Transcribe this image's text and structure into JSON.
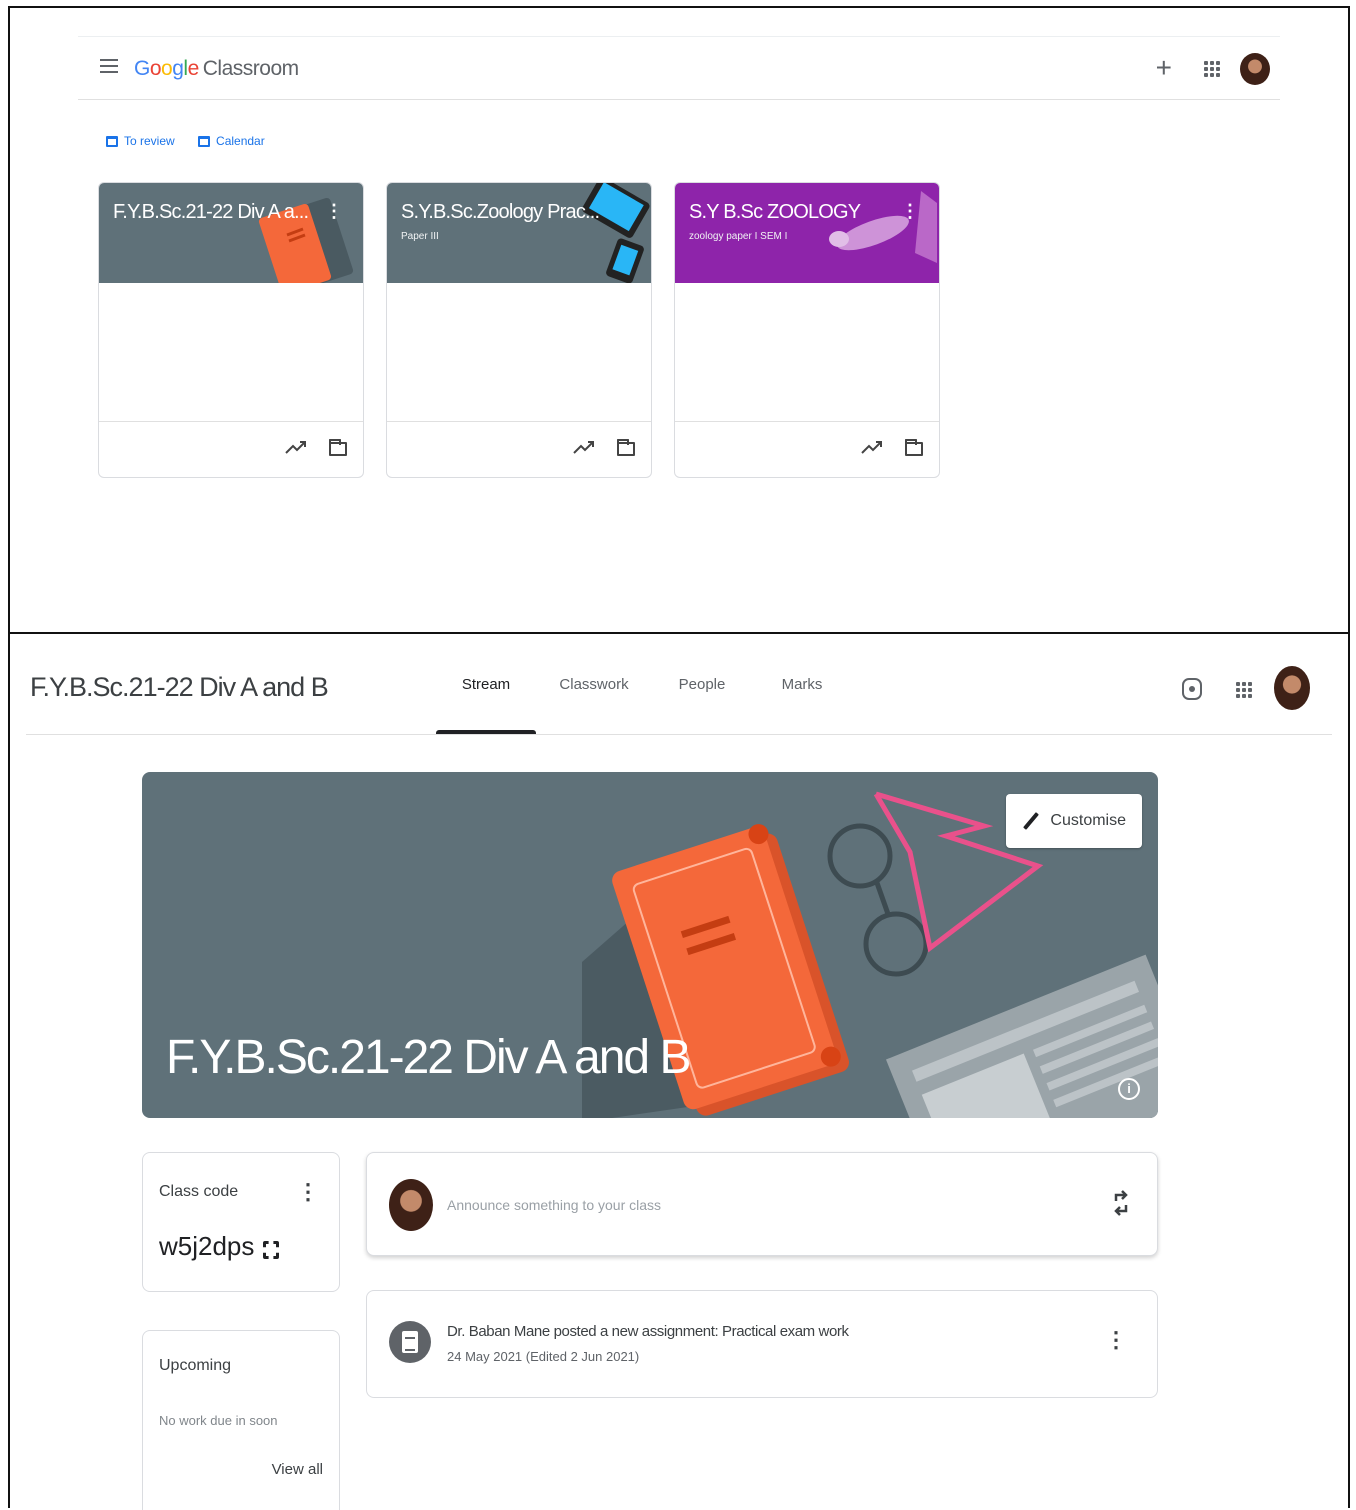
{
  "home": {
    "brand": {
      "google": [
        "G",
        "o",
        "o",
        "g",
        "l",
        "e"
      ],
      "product": "Classroom"
    },
    "quicklinks": {
      "to_review": "To review",
      "calendar": "Calendar"
    },
    "cards": [
      {
        "title": "F.Y.B.Sc.21-22 Div A a...",
        "subtitle": "",
        "color": "#5f7179"
      },
      {
        "title": "S.Y.B.Sc.Zoology Prac...",
        "subtitle": "Paper III",
        "color": "#5f7179"
      },
      {
        "title": "S.Y B.Sc ZOOLOGY",
        "subtitle": "zoology paper I SEM I",
        "color": "#8e24aa"
      }
    ],
    "icons": {
      "menu": "menu-icon",
      "add": "plus-icon",
      "apps": "apps-icon",
      "account": "avatar",
      "trend": "trending-icon",
      "folder": "folder-icon"
    }
  },
  "classpage": {
    "class_name": "F.Y.B.Sc.21-22 Div A and B",
    "tabs": [
      "Stream",
      "Classwork",
      "People",
      "Marks"
    ],
    "active_tab": "Stream",
    "banner": {
      "title": "F.Y.B.Sc.21-22 Div A and B",
      "customise": "Customise",
      "info": "i"
    },
    "class_code": {
      "label": "Class code",
      "value": "w5j2dps"
    },
    "upcoming": {
      "title": "Upcoming",
      "empty": "No work due in soon",
      "view_all": "View all"
    },
    "announce": {
      "placeholder": "Announce something to your class"
    },
    "post": {
      "text": "Dr. Baban Mane posted a new assignment: Practical exam work",
      "date": "24 May 2021 (Edited 2 Jun 2021)"
    }
  },
  "colors": {
    "accent": "#1a73e8",
    "banner": "#5f7179",
    "book": "#f4683a",
    "purple": "#8e24aa"
  }
}
